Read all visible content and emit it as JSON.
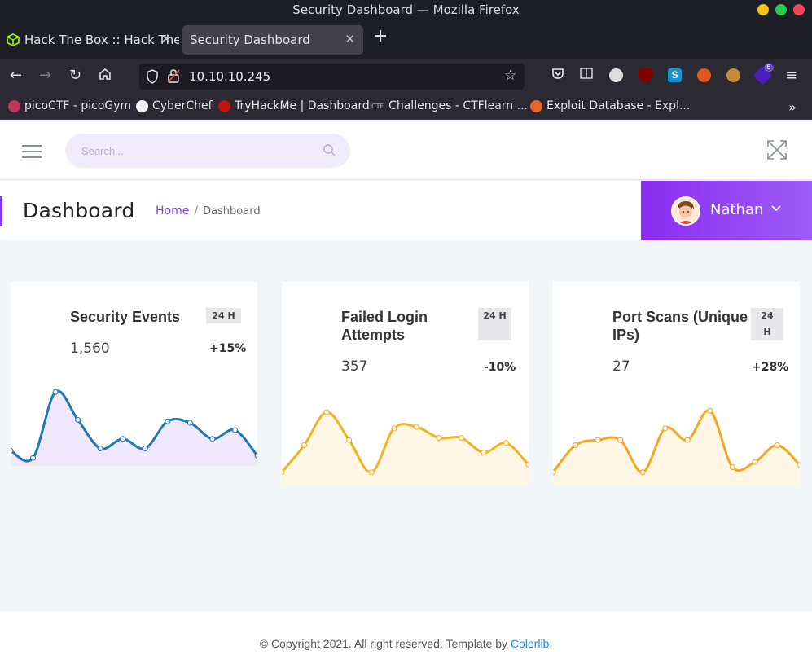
{
  "window": {
    "title": "Security Dashboard — Mozilla Firefox"
  },
  "tabs": [
    {
      "label": "Hack The Box :: Hack The",
      "icon": "hackthebox-icon"
    },
    {
      "label": "Security Dashboard"
    }
  ],
  "nav": {
    "url": "10.10.10.245",
    "ext_badge": "8"
  },
  "bookmarks": [
    {
      "label": "picoCTF - picoGym"
    },
    {
      "label": "CyberChef"
    },
    {
      "label": "TryHackMe | Dashboard"
    },
    {
      "label": "Challenges - CTFlearn ..."
    },
    {
      "label": "Exploit Database - Expl..."
    }
  ],
  "page": {
    "search_placeholder": "Search...",
    "title": "Dashboard",
    "breadcrumb": {
      "home": "Home",
      "sep": "/",
      "current": "Dashboard"
    },
    "user": "Nathan",
    "footer": {
      "text": "© Copyright 2021. All right reserved. Template by ",
      "link": "Colorlib",
      "end": "."
    }
  },
  "cards": [
    {
      "title": "Security Events",
      "badge": "24 H",
      "value": "1,560",
      "change": "+15%",
      "color": "#1f77b4",
      "fill": "#f0e8fd",
      "points": [
        0.88,
        0.98,
        0.08,
        0.46,
        0.85,
        0.72,
        0.85,
        0.48,
        0.5,
        0.72,
        0.6,
        0.95
      ]
    },
    {
      "title": "Failed Login Attempts",
      "badge": "24 H",
      "value": "357",
      "change": "-10%",
      "color": "#f0b323",
      "fill": "#fff6e6",
      "points": [
        0.92,
        0.55,
        0.1,
        0.48,
        0.92,
        0.32,
        0.3,
        0.45,
        0.45,
        0.65,
        0.52,
        0.82
      ]
    },
    {
      "title": "Port Scans (Unique IPs)",
      "badge": "24 H",
      "value": "27",
      "change": "+28%",
      "color": "#f5a623",
      "fill": "#fff6e6",
      "points": [
        0.92,
        0.55,
        0.48,
        0.48,
        0.92,
        0.32,
        0.48,
        0.08,
        0.85,
        0.78,
        0.55,
        0.82
      ]
    }
  ]
}
